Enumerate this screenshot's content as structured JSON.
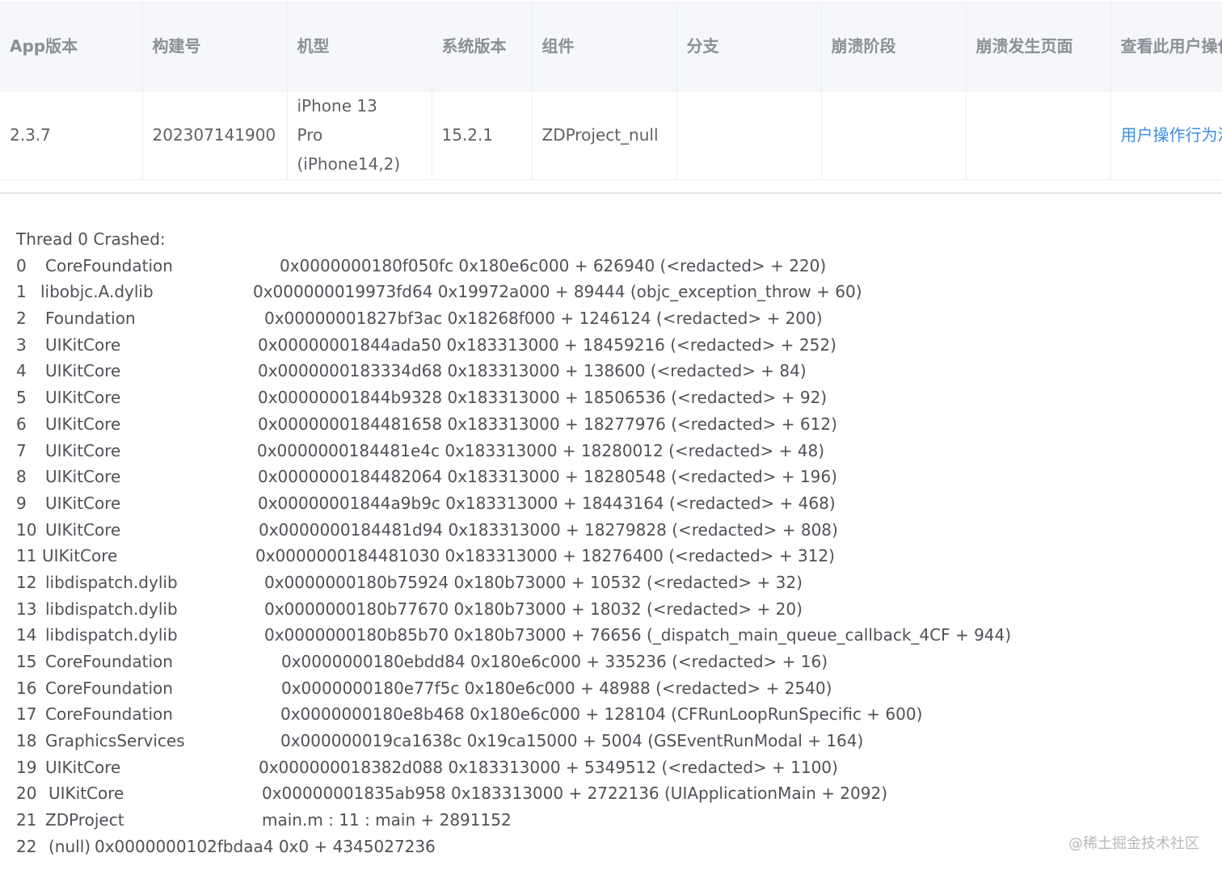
{
  "table": {
    "headers": [
      "App版本",
      "构建号",
      "机型",
      "系统版本",
      "组件",
      "分支",
      "崩溃阶段",
      "崩溃发生页面",
      "查看此用户操作行为流"
    ],
    "row": {
      "app_version": "2.3.7",
      "build": "202307141900",
      "device": "iPhone 13 Pro (iPhone14,2)",
      "os_version": "15.2.1",
      "component": "ZDProject_null",
      "branch": "",
      "crash_stage": "",
      "crash_page": "",
      "user_flow_link": "用户操作行为流"
    }
  },
  "trace": {
    "title": "Thread 0 Crashed:",
    "frames": [
      {
        "num": "0",
        "lib": "CoreFoundation",
        "addr": "0x0000000180f050fc 0x180e6c000 + 626940 (<redacted> + 220)"
      },
      {
        "num": "1",
        "lib": "libobjc.A.dylib",
        "addr": "0x000000019973fd64 0x19972a000 + 89444 (objc_exception_throw + 60)"
      },
      {
        "num": "2",
        "lib": "Foundation",
        "addr": "0x00000001827bf3ac 0x18268f000 + 1246124 (<redacted> + 200)"
      },
      {
        "num": "3",
        "lib": "UIKitCore",
        "addr": "0x00000001844ada50 0x183313000 + 18459216 (<redacted> + 252)"
      },
      {
        "num": "4",
        "lib": "UIKitCore",
        "addr": "0x0000000183334d68 0x183313000 + 138600 (<redacted> + 84)"
      },
      {
        "num": "5",
        "lib": "UIKitCore",
        "addr": "0x00000001844b9328 0x183313000 + 18506536 (<redacted> + 92)"
      },
      {
        "num": "6",
        "lib": "UIKitCore",
        "addr": "0x0000000184481658 0x183313000 + 18277976 (<redacted> + 612)"
      },
      {
        "num": "7",
        "lib": "UIKitCore",
        "addr": "0x0000000184481e4c 0x183313000 + 18280012 (<redacted> + 48)"
      },
      {
        "num": "8",
        "lib": "UIKitCore",
        "addr": "0x0000000184482064 0x183313000 + 18280548 (<redacted> + 196)"
      },
      {
        "num": "9",
        "lib": "UIKitCore",
        "addr": "0x00000001844a9b9c 0x183313000 + 18443164 (<redacted> + 468)"
      },
      {
        "num": "10",
        "lib": "UIKitCore",
        "addr": "0x0000000184481d94 0x183313000 + 18279828 (<redacted> + 808)"
      },
      {
        "num": "11",
        "lib": "UIKitCore",
        "addr": "0x0000000184481030 0x183313000 + 18276400 (<redacted> + 312)"
      },
      {
        "num": "12",
        "lib": "libdispatch.dylib",
        "addr": "0x0000000180b75924 0x180b73000 + 10532 (<redacted> + 32)"
      },
      {
        "num": "13",
        "lib": "libdispatch.dylib",
        "addr": "0x0000000180b77670 0x180b73000 + 18032 (<redacted> + 20)"
      },
      {
        "num": "14",
        "lib": "libdispatch.dylib",
        "addr": "0x0000000180b85b70 0x180b73000 + 76656 (_dispatch_main_queue_callback_4CF + 944)"
      },
      {
        "num": "15",
        "lib": "CoreFoundation",
        "addr": "0x0000000180ebdd84 0x180e6c000 + 335236 (<redacted> + 16)"
      },
      {
        "num": "16",
        "lib": "CoreFoundation",
        "addr": "0x0000000180e77f5c 0x180e6c000 + 48988 (<redacted> + 2540)"
      },
      {
        "num": "17",
        "lib": "CoreFoundation",
        "addr": "0x0000000180e8b468 0x180e6c000 + 128104 (CFRunLoopRunSpecific + 600)"
      },
      {
        "num": "18",
        "lib": "GraphicsServices",
        "addr": "0x000000019ca1638c 0x19ca15000 + 5004 (GSEventRunModal + 164)"
      },
      {
        "num": "19",
        "lib": "UIKitCore",
        "addr": "0x000000018382d088 0x183313000 + 5349512 (<redacted> + 1100)"
      },
      {
        "num": "20",
        "lib": "UIKitCore",
        "addr": "0x00000001835ab958 0x183313000 + 2722136 (UIApplicationMain + 2092)"
      },
      {
        "num": "21",
        "lib": "ZDProject",
        "addr": "main.m : 11 : main  + 2891152"
      },
      {
        "num": "22",
        "lib": "(null)",
        "addr": "0x0000000102fbdaa4 0x0 + 4345027236"
      }
    ]
  },
  "watermark": "@稀土掘金技术社区"
}
